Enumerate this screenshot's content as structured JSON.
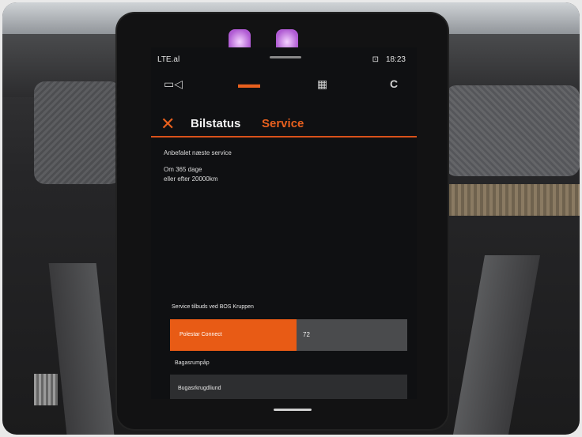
{
  "statusbar": {
    "carrier": "LTE.al",
    "time": "18:23",
    "icon": "battery-icon"
  },
  "toolbar": {
    "camera_icon": "camera-icon",
    "car_icon": "car-icon",
    "grid_icon": "apps-grid-icon",
    "refresh_icon": "refresh-icon",
    "refresh_label": "C"
  },
  "header": {
    "close_glyph": "✕",
    "title": "Bilstatus",
    "tab_service": "Service"
  },
  "next_service": {
    "label": "Anbefalet næste service",
    "line1": "Om 365 dage",
    "line2": "eller efter 20000km"
  },
  "dealer": {
    "label": "Service tilbuds ved BOS Kruppen",
    "name": "Polestar Connect",
    "edit_value": "72"
  },
  "option": {
    "label": "Bagasrumpåp",
    "value": "Bugasrkrugdliund"
  },
  "colors": {
    "accent": "#e8601e",
    "screen_bg": "#0f1012",
    "row_bg": "#2d2e30"
  }
}
